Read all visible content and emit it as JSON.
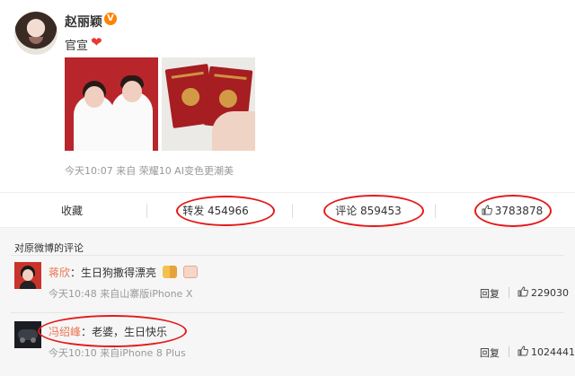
{
  "post": {
    "author_name": "赵丽颖",
    "badge": "V",
    "text": "官宣",
    "heart_icon": "heart-icon",
    "meta": "今天10:07 来自 荣耀10 AI变色更潮美"
  },
  "actions": {
    "favorite": "收藏",
    "repost": "转发 454966",
    "comment": "评论 859453",
    "like_count": "3783878"
  },
  "comments": {
    "header": "对原微博的评论",
    "items": [
      {
        "name": "蒋欣",
        "text": "：生日狗撒得漂亮",
        "meta": "今天10:48 来自山寨版iPhone X",
        "reply": "回复",
        "likes": "229030"
      },
      {
        "name": "冯绍峰",
        "text": "：老婆，生日快乐",
        "meta": "今天10:10 来自iPhone 8 Plus",
        "reply": "回复",
        "likes": "1024441"
      }
    ]
  },
  "colors": {
    "annotation_red": "#e31b1b",
    "username_orange": "#eb7350",
    "weibo_badge": "#ff8200"
  }
}
